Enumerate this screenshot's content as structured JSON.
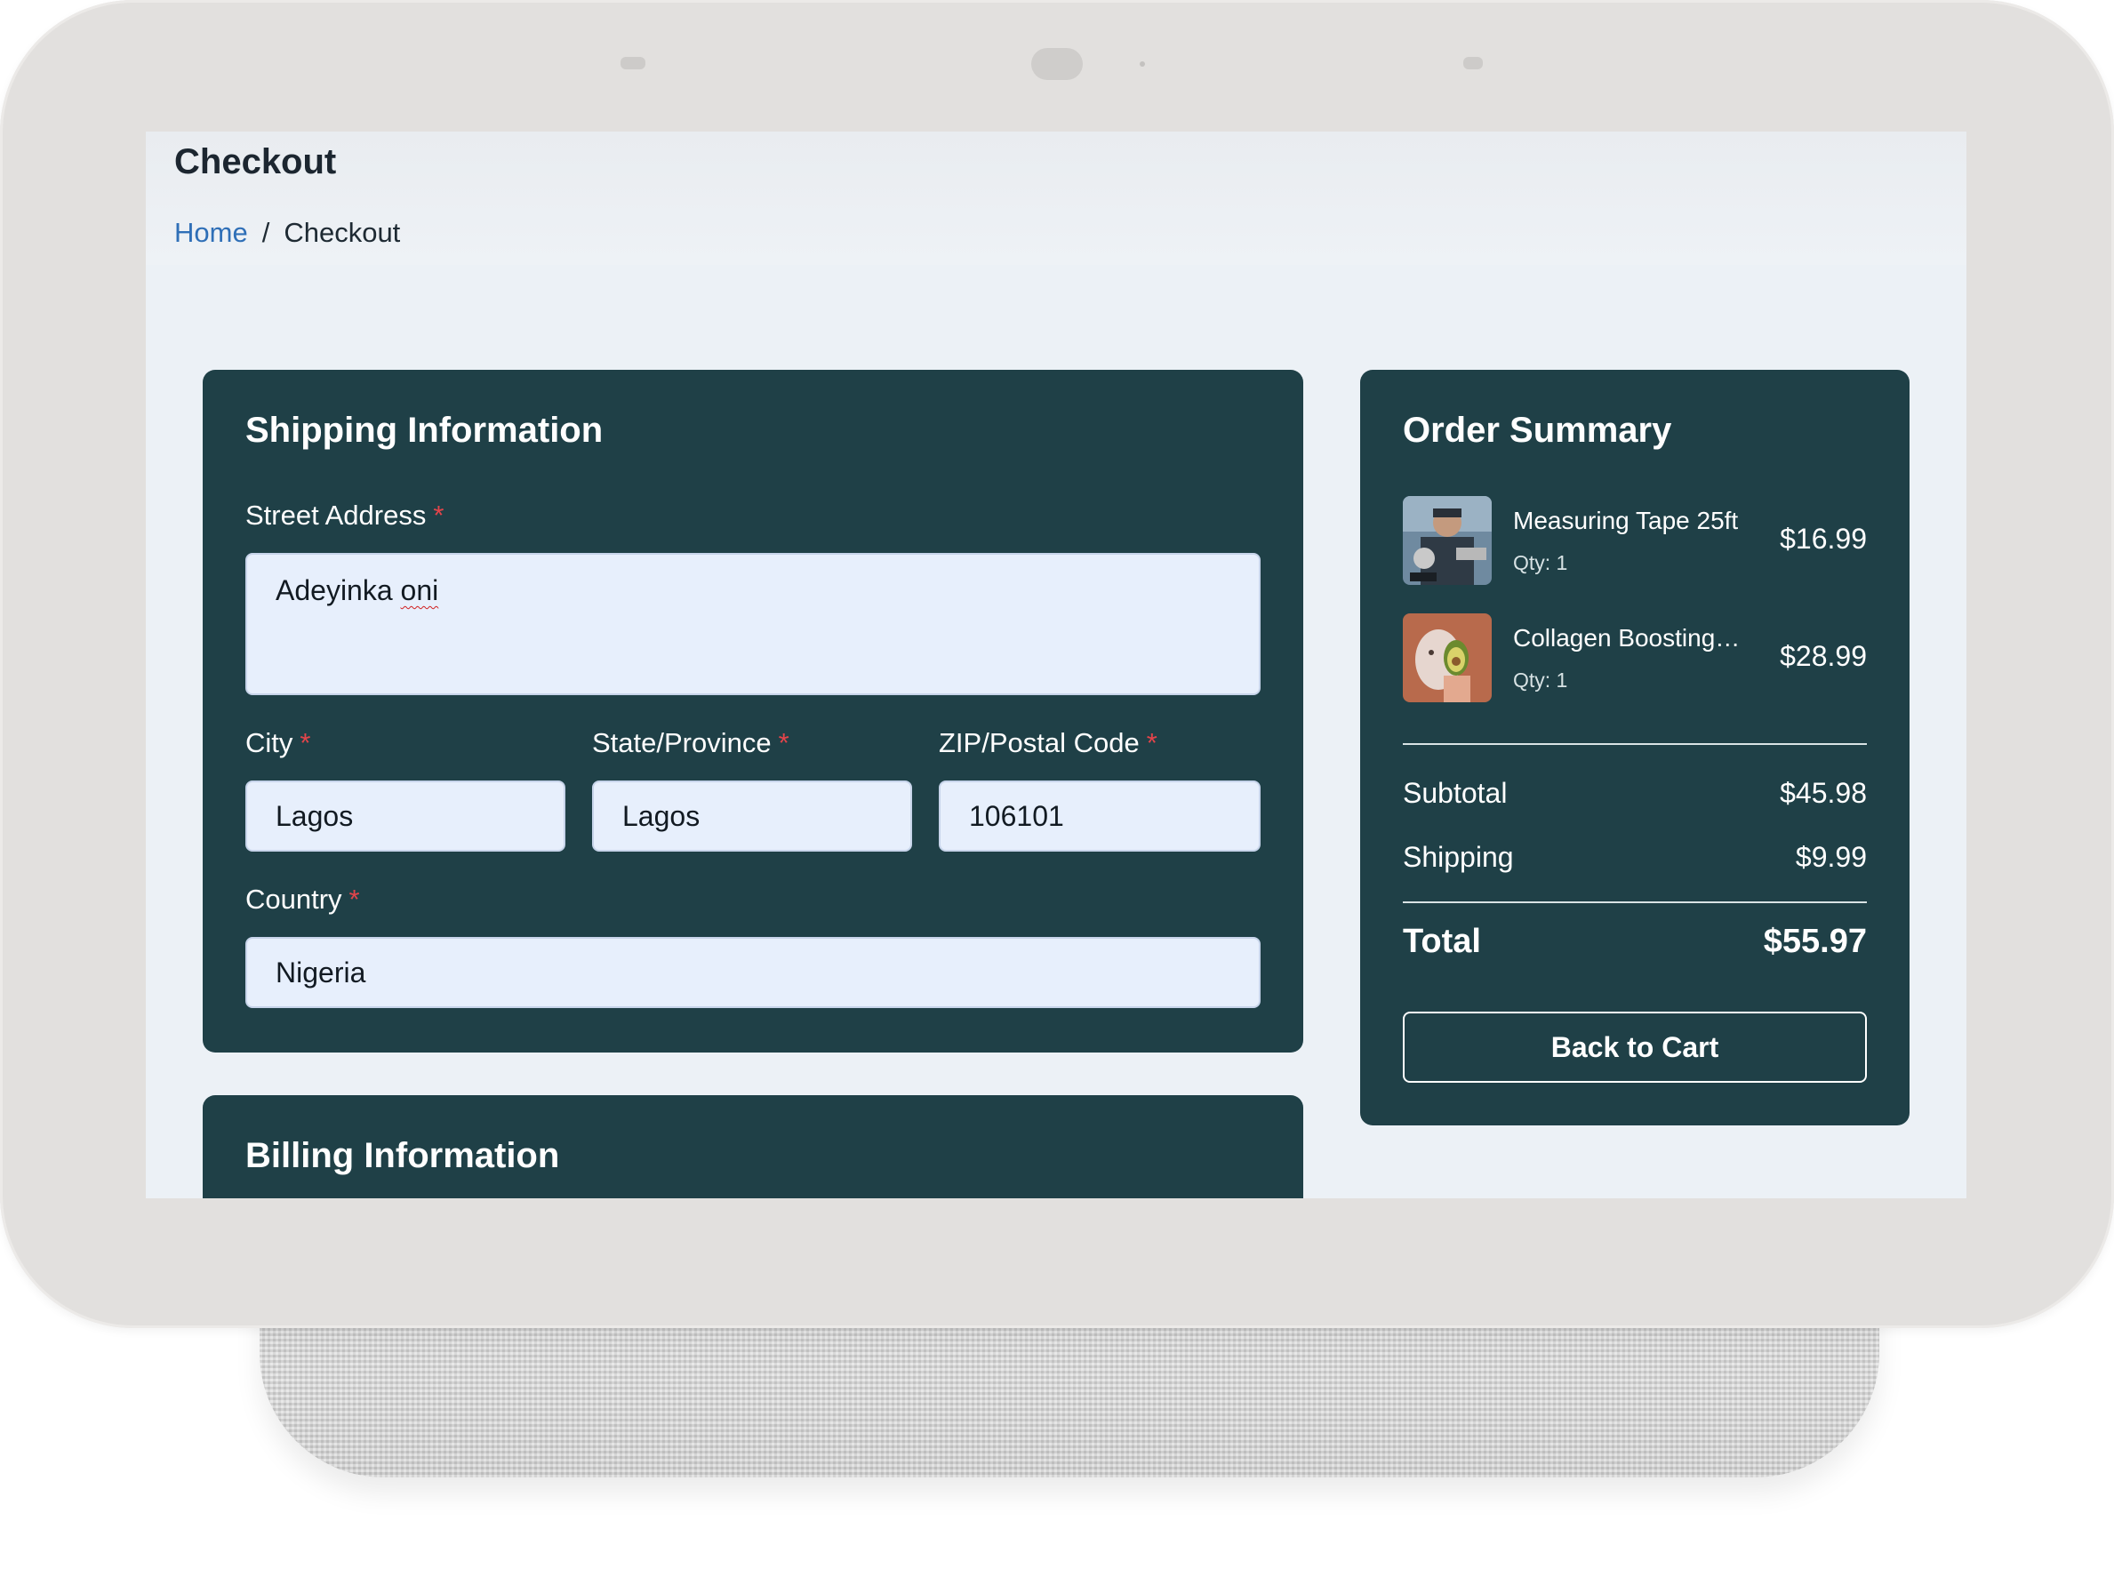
{
  "header": {
    "title": "Checkout",
    "breadcrumb": {
      "home": "Home",
      "separator": "/",
      "current": "Checkout"
    }
  },
  "shipping": {
    "title": "Shipping Information",
    "required_marker": "*",
    "street": {
      "label": "Street Address",
      "value_first": "Adeyinka",
      "value_second": "oni"
    },
    "city": {
      "label": "City",
      "value": "Lagos"
    },
    "state": {
      "label": "State/Province",
      "value": "Lagos"
    },
    "zip": {
      "label": "ZIP/Postal Code",
      "value": "106101"
    },
    "country": {
      "label": "Country",
      "value": "Nigeria"
    }
  },
  "billing": {
    "title": "Billing Information"
  },
  "summary": {
    "title": "Order Summary",
    "items": [
      {
        "name": "Measuring Tape 25ft",
        "qty": "Qty: 1",
        "price": "$16.99",
        "thumb_icon": "measuring-tape-photo"
      },
      {
        "name": "Collagen Boosting…",
        "qty": "Qty: 1",
        "price": "$28.99",
        "thumb_icon": "face-mask-avocado-photo"
      }
    ],
    "subtotal_label": "Subtotal",
    "subtotal_value": "$45.98",
    "shipping_label": "Shipping",
    "shipping_value": "$9.99",
    "total_label": "Total",
    "total_value": "$55.97",
    "back_button": "Back to Cart"
  },
  "colors": {
    "card": "#1f4047",
    "screen_bg": "#ecf1f6",
    "input_bg": "#e7effc",
    "link": "#2f6fb7",
    "required": "#e2444a"
  }
}
